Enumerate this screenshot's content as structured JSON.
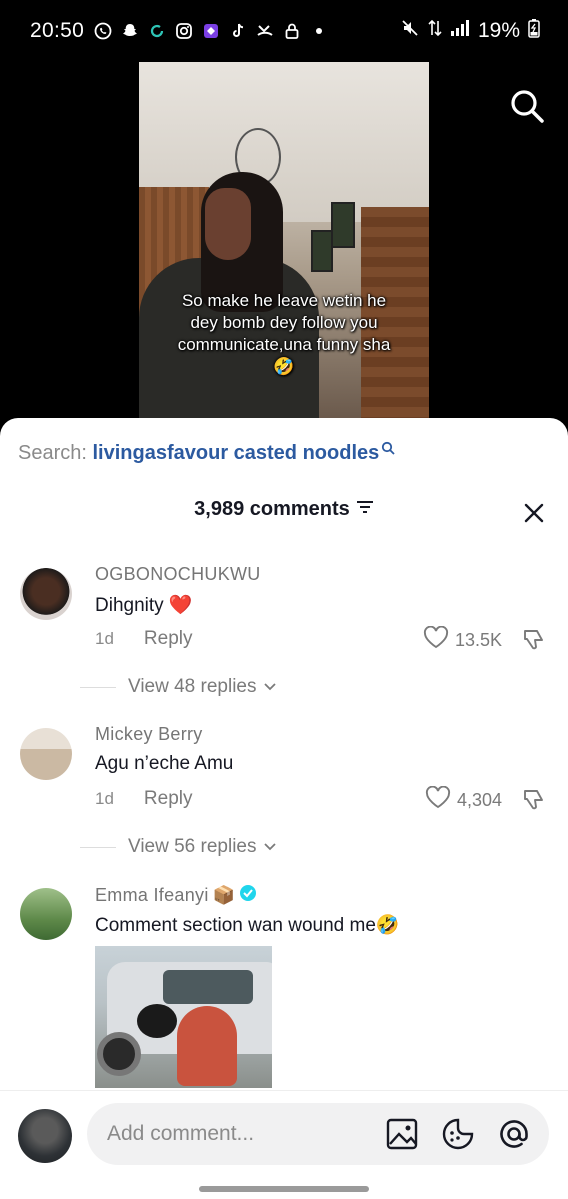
{
  "status_bar": {
    "time": "20:50",
    "battery": "19%",
    "icons": [
      "whatsapp-icon",
      "snapchat-icon",
      "sync-icon",
      "instagram-icon",
      "app-icon",
      "tiktok-icon",
      "missed-call-icon",
      "lock-icon",
      "dot-icon",
      "mute-icon",
      "data-icon",
      "signal-icon",
      "battery-icon"
    ]
  },
  "video": {
    "caption": "So make he leave wetin he dey bomb dey follow you communicate,una funny sha🤣"
  },
  "search": {
    "label": "Search:",
    "query": "livingasfavour casted noodles"
  },
  "header": {
    "title": "3,989 comments"
  },
  "comments": [
    {
      "author": "OGBONOCHUKWU",
      "text": "Dihgnity ❤️",
      "age": "1d",
      "reply_label": "Reply",
      "likes": "13.5K",
      "view_replies": "View 48 replies"
    },
    {
      "author": "Mickey Berry",
      "text": "Agu n’eche Amu",
      "age": "1d",
      "reply_label": "Reply",
      "likes": "4,304",
      "view_replies": "View 56 replies"
    },
    {
      "author": "Emma Ifeanyi",
      "author_badge": "📦",
      "text": "Comment section wan wound me🤣"
    }
  ],
  "input": {
    "placeholder": "Add comment..."
  },
  "colors": {
    "accent_link": "#2c5aa0",
    "heart_red": "#e0243a",
    "verified_blue": "#20d5ec"
  }
}
